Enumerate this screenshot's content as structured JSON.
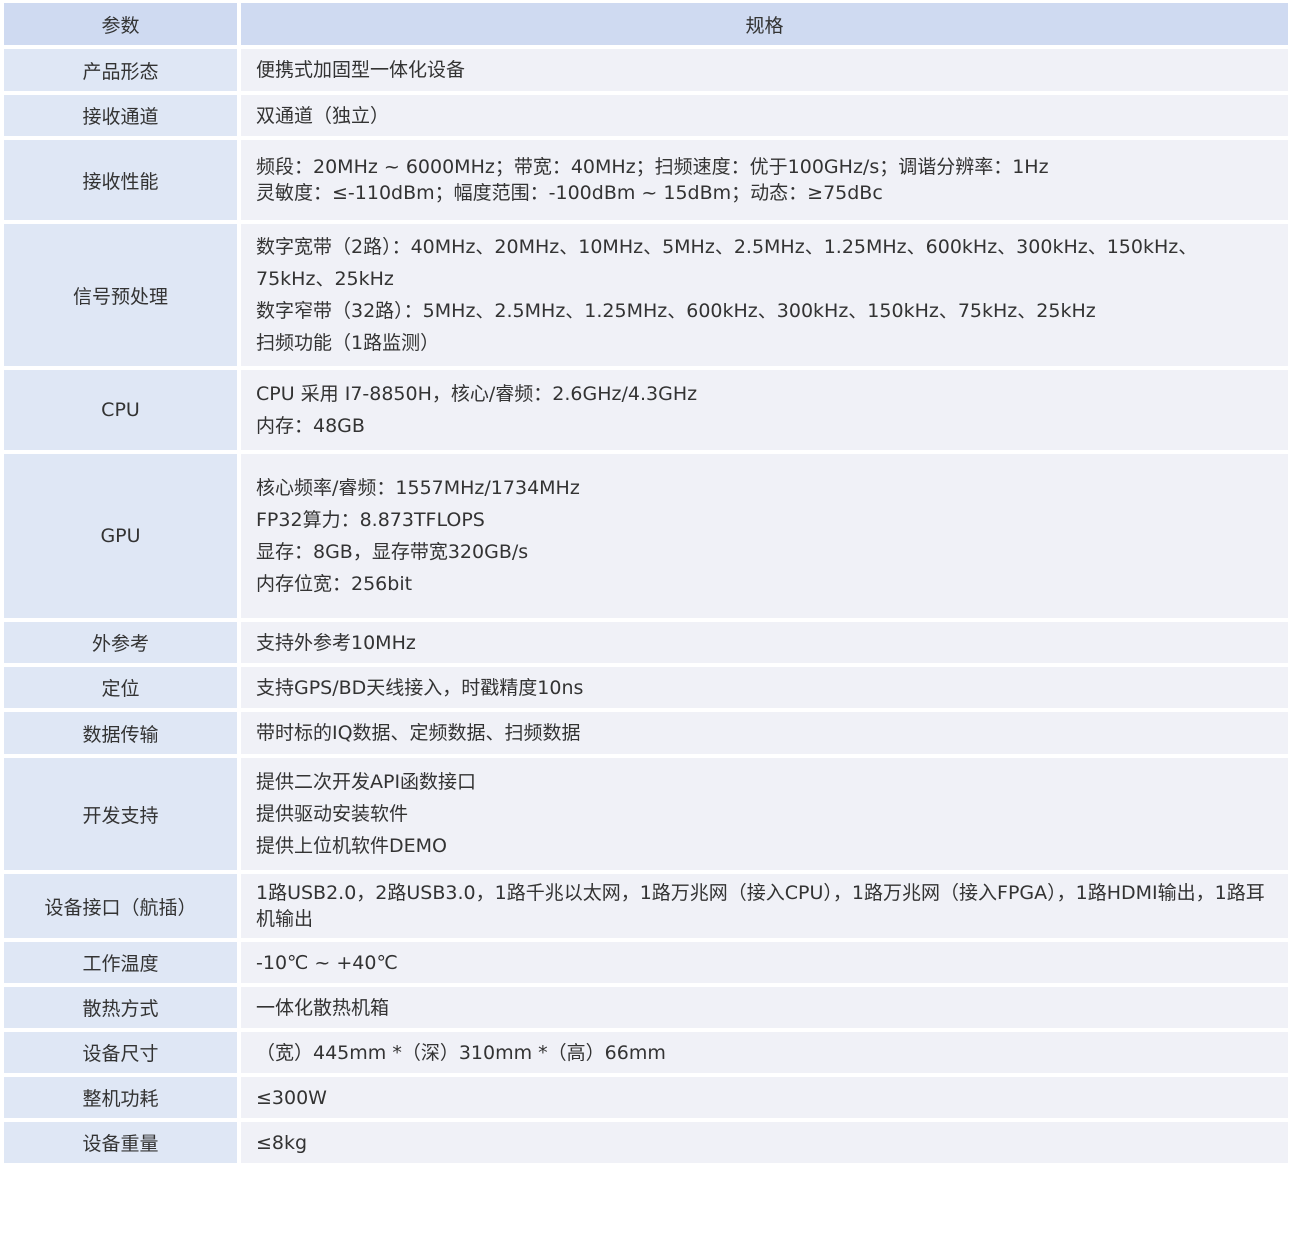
{
  "table": {
    "headers": {
      "param": "参数",
      "spec": "规格"
    },
    "rows": [
      {
        "param": "产品形态",
        "lines": [
          "便携式加固型一体化设备"
        ]
      },
      {
        "param": "接收通道",
        "lines": [
          "双通道（独立）"
        ]
      },
      {
        "param": "接收性能",
        "lines": [
          "频段：20MHz ~ 6000MHz；带宽：40MHz；扫频速度：优于100GHz/s；调谐分辨率：1Hz",
          "灵敏度：≤-110dBm；幅度范围：-100dBm ~ 15dBm；动态：≥75dBc"
        ]
      },
      {
        "param": "信号预处理",
        "lines": [
          "数字宽带（2路）：40MHz、20MHz、10MHz、5MHz、2.5MHz、1.25MHz、600kHz、300kHz、150kHz、75kHz、25kHz",
          "数字窄带（32路）：5MHz、2.5MHz、1.25MHz、600kHz、300kHz、150kHz、75kHz、25kHz",
          "扫频功能（1路监测）"
        ]
      },
      {
        "param": "CPU",
        "lines": [
          "CPU 采用 I7-8850H，核心/睿频：2.6GHz/4.3GHz",
          "内存：48GB"
        ]
      },
      {
        "param": "GPU",
        "lines": [
          "核心频率/睿频：1557MHz/1734MHz",
          "FP32算力：8.873TFLOPS",
          "显存：8GB，显存带宽320GB/s",
          "内存位宽：256bit"
        ]
      },
      {
        "param": "外参考",
        "lines": [
          "支持外参考10MHz"
        ]
      },
      {
        "param": "定位",
        "lines": [
          "支持GPS/BD天线接入，时戳精度10ns"
        ]
      },
      {
        "param": "数据传输",
        "lines": [
          "带时标的IQ数据、定频数据、扫频数据"
        ]
      },
      {
        "param": "开发支持",
        "lines": [
          "提供二次开发API函数接口",
          "提供驱动安装软件",
          "提供上位机软件DEMO"
        ]
      },
      {
        "param": "设备接口（航插）",
        "lines": [
          "1路USB2.0，2路USB3.0，1路千兆以太网，1路万兆网（接入CPU），1路万兆网（接入FPGA），1路HDMI输出，1路耳机输出"
        ]
      },
      {
        "param": "工作温度",
        "lines": [
          "-10℃ ~ +40℃"
        ]
      },
      {
        "param": "散热方式",
        "lines": [
          "一体化散热机箱"
        ]
      },
      {
        "param": "设备尺寸",
        "lines": [
          "（宽）445mm *（深）310mm *（高）66mm"
        ]
      },
      {
        "param": "整机功耗",
        "lines": [
          "≤300W"
        ]
      },
      {
        "param": "设备重量",
        "lines": [
          "≤8kg"
        ]
      }
    ]
  },
  "colors": {
    "header_bg": "#cfdaf1",
    "param_bg": "#dfe7f5",
    "spec_bg": "#f0f1f7",
    "text": "#333333"
  }
}
